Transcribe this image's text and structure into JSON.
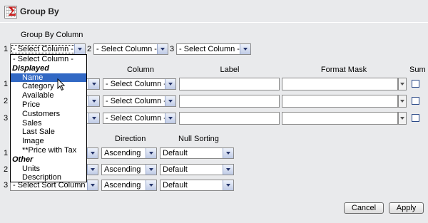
{
  "header": {
    "title": "Group By",
    "icon": "sigma-table-icon"
  },
  "group_by": {
    "label": "Group By Column",
    "rows": [
      {
        "num": "1",
        "value": "- Select Column -"
      },
      {
        "num": "2",
        "value": "- Select Column -"
      },
      {
        "num": "3",
        "value": "- Select Column -"
      }
    ]
  },
  "functions": {
    "headers": {
      "column": "Column",
      "label": "Label",
      "format_mask": "Format Mask",
      "sum": "Sum"
    },
    "rows": [
      {
        "num": "1",
        "function": "",
        "column": "- Select Column -",
        "label": "",
        "format_mask": "",
        "sum": false
      },
      {
        "num": "2",
        "function": "",
        "column": "- Select Column -",
        "label": "",
        "format_mask": "",
        "sum": false
      },
      {
        "num": "3",
        "function": "",
        "column": "- Select Column -",
        "label": "",
        "format_mask": "",
        "sum": false
      }
    ]
  },
  "sort": {
    "headers": {
      "direction": "Direction",
      "null_sorting": "Null Sorting"
    },
    "rows": [
      {
        "num": "1",
        "column": "",
        "direction": "Ascending",
        "null_sorting": "Default"
      },
      {
        "num": "2",
        "column": "",
        "direction": "Ascending",
        "null_sorting": "Default"
      },
      {
        "num": "3",
        "column": "- Select Sort Column -",
        "direction": "Ascending",
        "null_sorting": "Default"
      }
    ]
  },
  "dropdown": {
    "items": [
      {
        "kind": "item",
        "label": "- Select Column -",
        "plain": true
      },
      {
        "kind": "group",
        "label": "Displayed"
      },
      {
        "kind": "item",
        "label": "Name",
        "selected": true
      },
      {
        "kind": "item",
        "label": "Category"
      },
      {
        "kind": "item",
        "label": "Available"
      },
      {
        "kind": "item",
        "label": "Price"
      },
      {
        "kind": "item",
        "label": "Customers"
      },
      {
        "kind": "item",
        "label": "Sales"
      },
      {
        "kind": "item",
        "label": "Last Sale"
      },
      {
        "kind": "item",
        "label": "Image"
      },
      {
        "kind": "item",
        "label": "**Price with Tax"
      },
      {
        "kind": "group",
        "label": "Other"
      },
      {
        "kind": "item",
        "label": "Units"
      },
      {
        "kind": "item",
        "label": "Description"
      }
    ]
  },
  "buttons": {
    "cancel": "Cancel",
    "apply": "Apply"
  },
  "colors": {
    "background": "#e9eaec",
    "selection": "#3168c4",
    "select_arrow": "#26356b"
  }
}
